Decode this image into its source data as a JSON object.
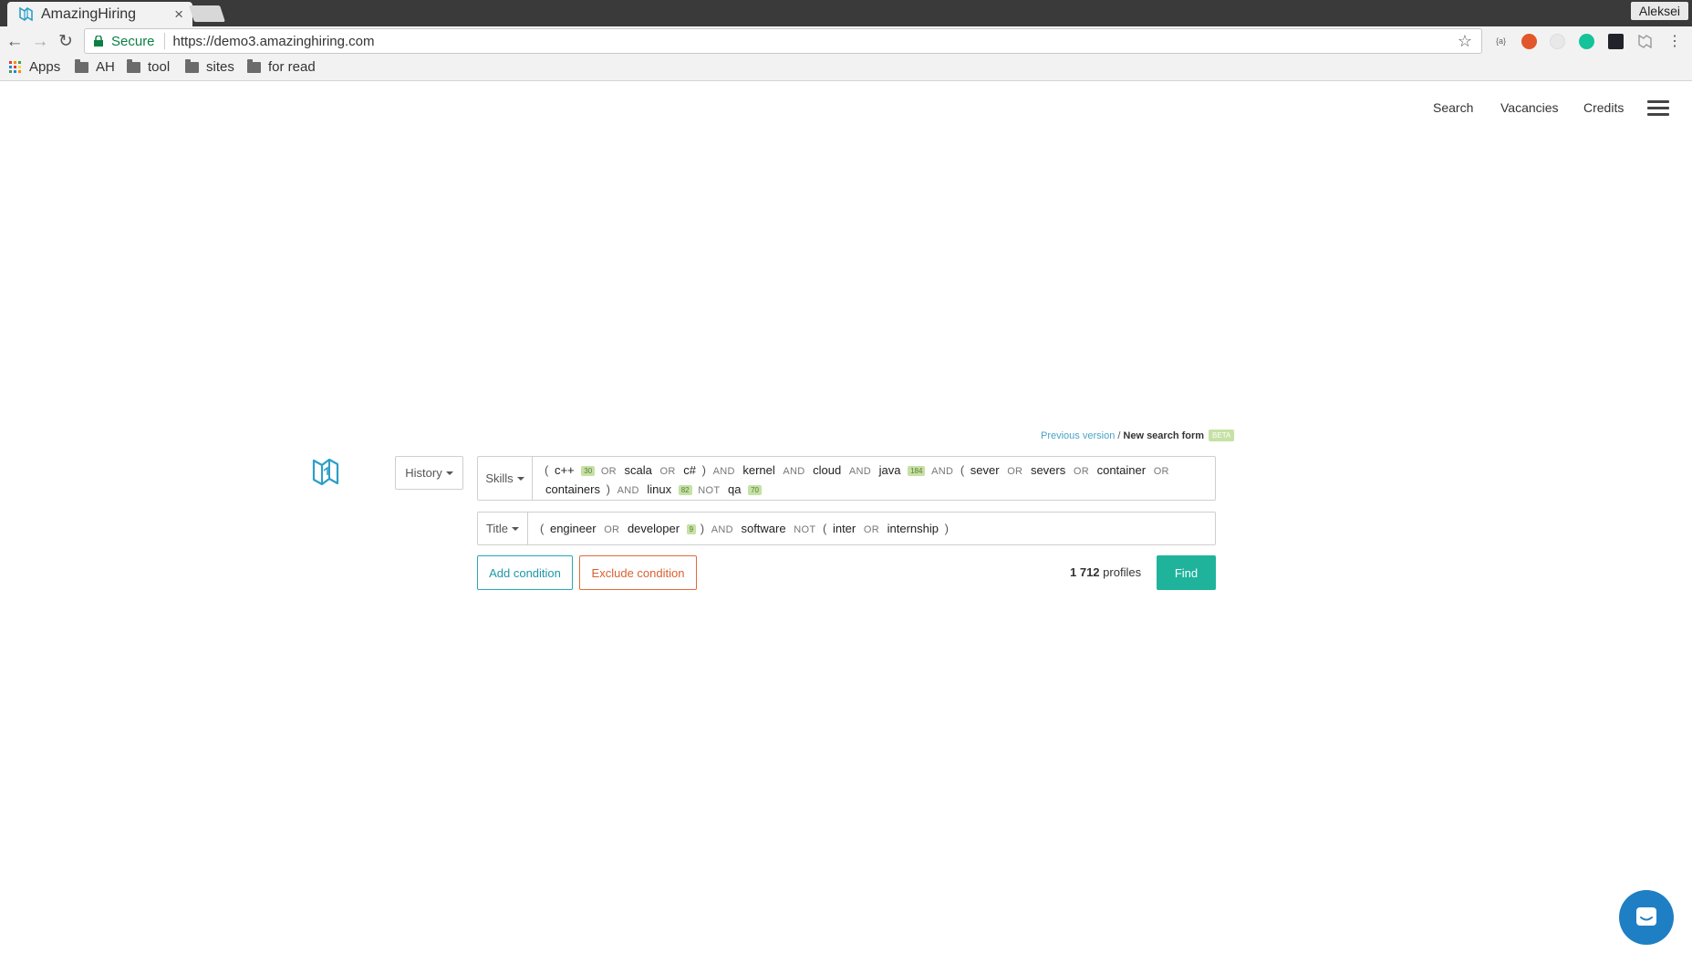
{
  "browser": {
    "tab_title": "AmazingHiring",
    "tab_close": "×",
    "user_name": "Aleksei",
    "secure_label": "Secure",
    "url": "https://demo3.amazinghiring.com",
    "back": "←",
    "forward": "→",
    "reload": "↻",
    "star": "☆",
    "menu": "⋮",
    "bookmarks": [
      {
        "label": "Apps",
        "icon": "apps-grid-icon"
      },
      {
        "label": "AH",
        "icon": "folder-icon"
      },
      {
        "label": "tool",
        "icon": "folder-icon"
      },
      {
        "label": "sites",
        "icon": "folder-icon"
      },
      {
        "label": "for read",
        "icon": "folder-icon"
      }
    ],
    "extensions": [
      "json-viewer-icon",
      "adblock-icon",
      "inactive-extension-icon",
      "grammarly-icon",
      "react-devtools-icon",
      "amazinghiring-extension-icon"
    ]
  },
  "nav": {
    "search": "Search",
    "vacancies": "Vacancies",
    "credits": "Credits",
    "menu_icon": "hamburger-icon"
  },
  "version": {
    "previous": "Previous version",
    "slash": "/",
    "new_form": "New search form",
    "beta": "BETA"
  },
  "form": {
    "history": "History",
    "skills_field": "Skills",
    "title_field": "Title",
    "skills_query": {
      "line1": [
        {
          "t": "paren",
          "v": "("
        },
        {
          "t": "kw",
          "v": "c++"
        },
        {
          "t": "cnt",
          "v": "30"
        },
        {
          "t": "op",
          "v": "OR"
        },
        {
          "t": "kw",
          "v": "scala"
        },
        {
          "t": "op",
          "v": "OR"
        },
        {
          "t": "kw",
          "v": "c#"
        },
        {
          "t": "paren",
          "v": ")"
        },
        {
          "t": "op",
          "v": "AND"
        },
        {
          "t": "kw",
          "v": "kernel"
        },
        {
          "t": "op",
          "v": "AND"
        },
        {
          "t": "kw",
          "v": "cloud"
        },
        {
          "t": "op",
          "v": "AND"
        },
        {
          "t": "kw",
          "v": "java"
        },
        {
          "t": "cnt",
          "v": "184"
        },
        {
          "t": "op",
          "v": "AND"
        },
        {
          "t": "paren",
          "v": "("
        },
        {
          "t": "kw",
          "v": "sever"
        },
        {
          "t": "op",
          "v": "OR"
        },
        {
          "t": "kw",
          "v": "severs"
        },
        {
          "t": "op",
          "v": "OR"
        },
        {
          "t": "kw",
          "v": "container"
        },
        {
          "t": "op",
          "v": "OR"
        }
      ],
      "line2": [
        {
          "t": "kw",
          "v": "containers"
        },
        {
          "t": "paren",
          "v": ")"
        },
        {
          "t": "op",
          "v": "AND"
        },
        {
          "t": "kw",
          "v": "linux"
        },
        {
          "t": "cnt",
          "v": "82"
        },
        {
          "t": "op",
          "v": "NOT"
        },
        {
          "t": "kw",
          "v": "qa"
        },
        {
          "t": "cnt",
          "v": "70"
        }
      ]
    },
    "title_query": [
      {
        "t": "paren",
        "v": "("
      },
      {
        "t": "kw",
        "v": "engineer"
      },
      {
        "t": "op",
        "v": "OR"
      },
      {
        "t": "kw",
        "v": "developer"
      },
      {
        "t": "cnt",
        "v": "9"
      },
      {
        "t": "paren",
        "v": ")"
      },
      {
        "t": "op",
        "v": "AND"
      },
      {
        "t": "kw",
        "v": "software"
      },
      {
        "t": "op",
        "v": "NOT"
      },
      {
        "t": "paren",
        "v": "("
      },
      {
        "t": "kw",
        "v": "inter"
      },
      {
        "t": "op",
        "v": "OR"
      },
      {
        "t": "kw",
        "v": "internship"
      },
      {
        "t": "paren",
        "v": ")"
      }
    ],
    "add_condition": "Add condition",
    "exclude_condition": "Exclude condition",
    "profiles_count": "1 712",
    "profiles_label": "profiles",
    "find": "Find"
  },
  "colors": {
    "teal": "#1fb39c",
    "add_border": "#26a9ba",
    "exclude": "#d8612f",
    "count_badge": "#c5e1a5",
    "chat": "#1f7fc4"
  }
}
